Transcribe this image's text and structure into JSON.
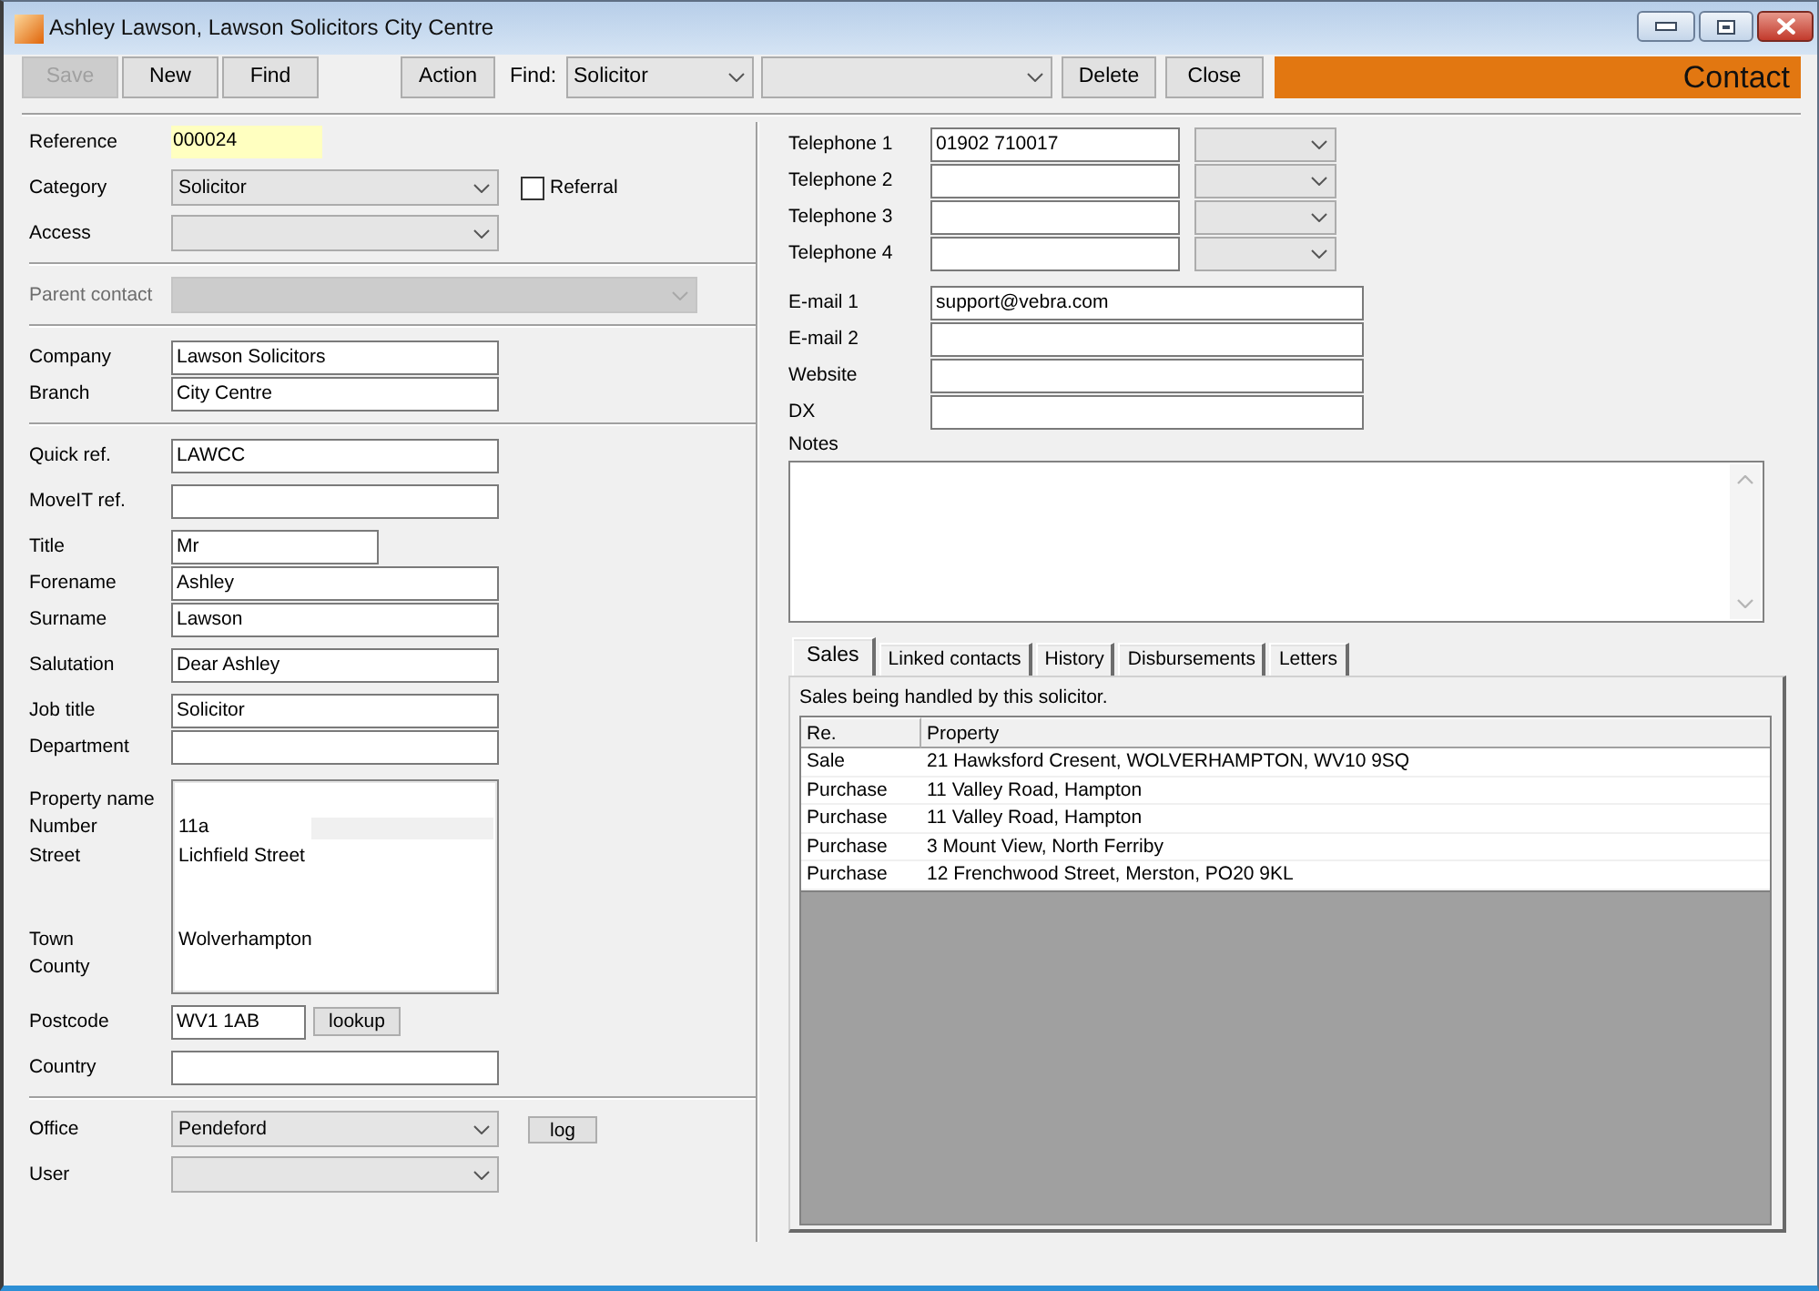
{
  "window": {
    "title": "Ashley Lawson, Lawson Solicitors City Centre"
  },
  "toolbar": {
    "buttons": [
      {
        "label": "Save",
        "disabled": true
      },
      {
        "label": "New",
        "disabled": false
      },
      {
        "label": "Find",
        "disabled": false
      }
    ],
    "action": "Action",
    "find_label": "Find:",
    "find_type": "Solicitor",
    "actions": [
      "Delete",
      "Close"
    ],
    "banner": "Contact"
  },
  "left_panel": {
    "sections": [
      [
        [
          {
            "kind": "highlight",
            "label": "Reference",
            "value": "000024"
          }
        ],
        [
          {
            "kind": "combo",
            "label": "Category",
            "value": "Solicitor",
            "checkbox": {
              "label": "Referral",
              "checked": false
            }
          }
        ],
        [
          {
            "kind": "combo",
            "label": "Access"
          }
        ]
      ],
      [
        [
          {
            "kind": "disabled-combo",
            "label": "Parent contact"
          }
        ]
      ],
      [
        [
          {
            "kind": "text",
            "label": "Company",
            "value": "Lawson Solicitors"
          },
          {
            "kind": "text",
            "label": "Branch",
            "value": "City Centre"
          }
        ]
      ],
      [
        [
          {
            "kind": "text",
            "label": "Quick ref.",
            "value": "LAWCC"
          }
        ],
        [
          {
            "kind": "text",
            "label": "MoveIT ref."
          }
        ],
        [
          {
            "kind": "short-text",
            "label": "Title",
            "value": "Mr"
          },
          {
            "kind": "text",
            "label": "Forename",
            "value": "Ashley"
          },
          {
            "kind": "text",
            "label": "Surname",
            "value": "Lawson"
          }
        ],
        [
          {
            "kind": "text",
            "label": "Salutation",
            "value": "Dear Ashley"
          }
        ],
        [
          {
            "kind": "text",
            "label": "Job title",
            "value": "Solicitor"
          },
          {
            "kind": "text",
            "label": "Department"
          }
        ],
        [
          {
            "kind": "address",
            "lines": [
              {
                "label": "Property name",
                "side_field": false
              },
              {
                "label": "Number",
                "value": "11a",
                "side_field": true
              },
              {
                "label": "Street",
                "value": "Lichfield Street",
                "side_field": false
              },
              {
                "side_field": false
              },
              {
                "side_field": false
              },
              {
                "label": "Town",
                "value": "Wolverhampton",
                "side_field": false
              },
              {
                "label": "County",
                "side_field": false
              }
            ]
          }
        ],
        [
          {
            "kind": "tiny-text",
            "label": "Postcode",
            "value": "WV1 1AB",
            "button": "lookup"
          }
        ],
        [
          {
            "kind": "text",
            "label": "Country"
          }
        ]
      ],
      [
        [
          {
            "kind": "combo",
            "label": "Office",
            "value": "Pendeford",
            "button": "log"
          }
        ],
        [
          {
            "kind": "combo",
            "label": "User"
          }
        ]
      ]
    ]
  },
  "contact_panel": {
    "phones": [
      {
        "label": "Telephone 1",
        "value": "01902 710017"
      },
      {
        "label": "Telephone 2"
      },
      {
        "label": "Telephone 3"
      },
      {
        "label": "Telephone 4"
      }
    ],
    "online": [
      {
        "label": "E-mail 1",
        "value": "support@vebra.com"
      },
      {
        "label": "E-mail 2"
      },
      {
        "label": "Website"
      },
      {
        "label": "DX"
      }
    ],
    "notes": {
      "label": "Notes"
    },
    "tabs": [
      {
        "label": "Sales",
        "selected": true
      },
      {
        "label": "Linked contacts",
        "selected": false
      },
      {
        "label": "History",
        "selected": false
      },
      {
        "label": "Disbursements",
        "selected": false
      },
      {
        "label": "Letters",
        "selected": false
      }
    ],
    "tab_content": {
      "description": "Sales being handled by this solicitor.",
      "table": {
        "columns": [
          "Re.",
          "Property"
        ],
        "rows": [
          [
            "Sale",
            "21 Hawksford Cresent, WOLVERHAMPTON, WV10 9SQ"
          ],
          [
            "Purchase",
            "11 Valley Road, Hampton"
          ],
          [
            "Purchase",
            "11 Valley Road, Hampton"
          ],
          [
            "Purchase",
            "3 Mount View, North Ferriby"
          ],
          [
            "Purchase",
            "12 Frenchwood Street, Merston, PO20 9KL"
          ]
        ]
      }
    }
  }
}
